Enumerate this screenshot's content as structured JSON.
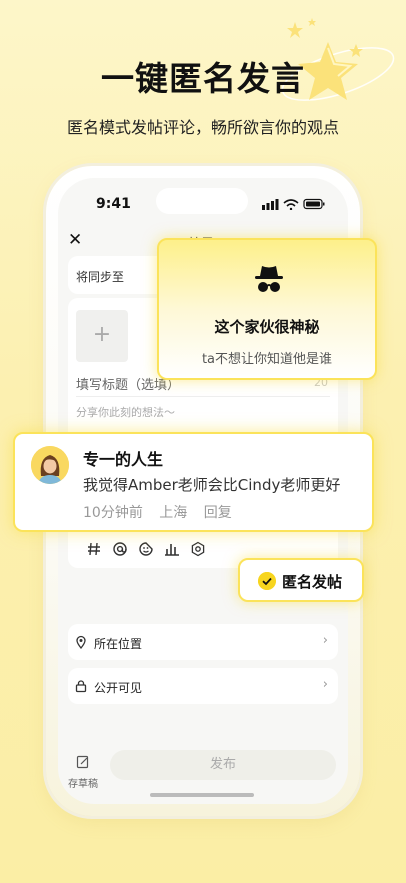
{
  "headline": "一键匿名发言",
  "subline": "匿名模式发帖评论，畅所欲言你的观点",
  "phone": {
    "status_time": "9:41",
    "nav": {
      "title": "帖子"
    },
    "sync_label": "将同步至",
    "editor": {
      "title_placeholder": "填写标题（选填）",
      "title_counter": "20",
      "body_placeholder": "分享你此刻的想法～"
    },
    "toolbar_icons": [
      "hashtag-icon",
      "at-icon",
      "sticker-icon",
      "chart-icon",
      "settings-icon"
    ],
    "location_label": "所在位置",
    "visibility_label": "公开可见",
    "draft_label": "存草稿",
    "publish_label": "发布"
  },
  "anon_card": {
    "title": "这个家伙很神秘",
    "subtitle": "ta不想让你知道他是谁"
  },
  "comment": {
    "name": "专一的人生",
    "text": "我觉得Amber老师会比Cindy老师更好",
    "time": "10分钟前",
    "location": "上海",
    "reply": "回复"
  },
  "anon_post_pill": {
    "label": "匿名发帖"
  },
  "colors": {
    "accent": "#fbe35a",
    "check": "#f7d51f",
    "background": "#fcf0b0"
  }
}
